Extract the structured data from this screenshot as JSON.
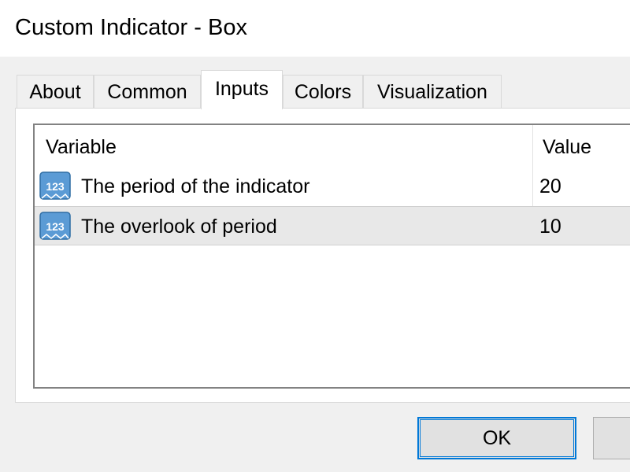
{
  "window": {
    "title": "Custom Indicator - Box"
  },
  "tabs": [
    {
      "label": "About"
    },
    {
      "label": "Common"
    },
    {
      "label": "Inputs"
    },
    {
      "label": "Colors"
    },
    {
      "label": "Visualization"
    }
  ],
  "active_tab": "Inputs",
  "inputs_table": {
    "headers": {
      "variable": "Variable",
      "value": "Value"
    },
    "rows": [
      {
        "icon": "numeric-123-icon",
        "name": "The period of the indicator",
        "value": "20"
      },
      {
        "icon": "numeric-123-icon",
        "name": "The overlook of period",
        "value": "10"
      }
    ]
  },
  "buttons": {
    "ok": "OK"
  },
  "colors": {
    "accent": "#0078d7",
    "icon_blue": "#5b9bd5"
  }
}
